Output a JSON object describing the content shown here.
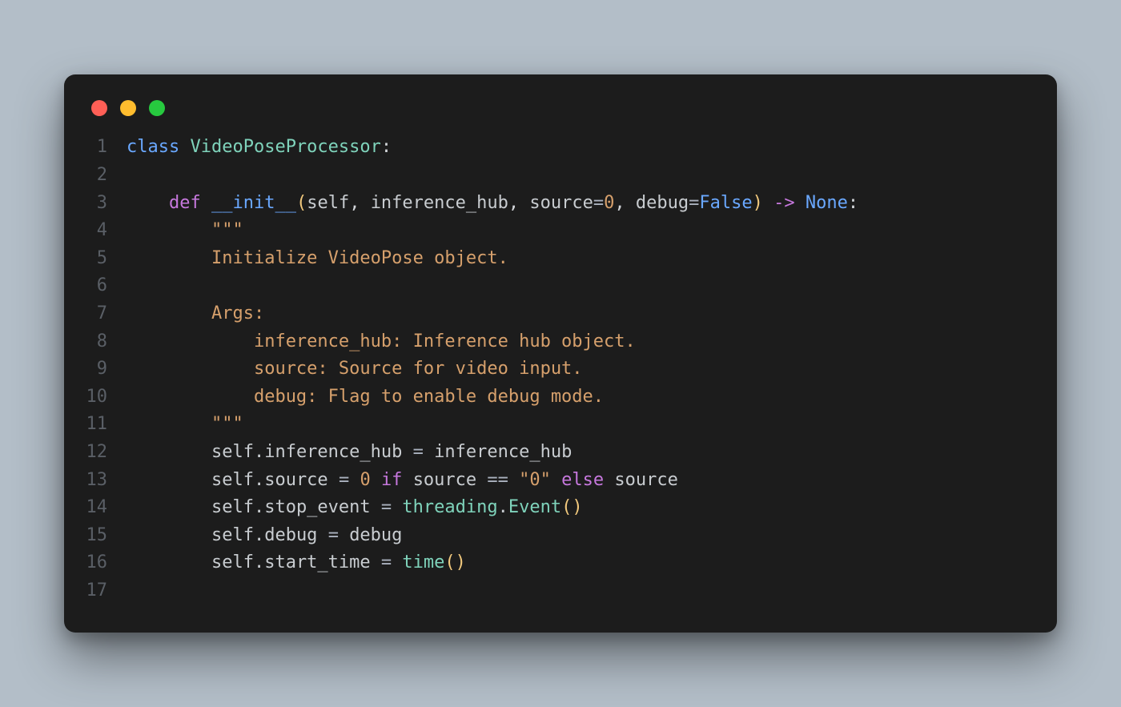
{
  "window": {
    "traffic_lights": [
      "close",
      "minimize",
      "zoom"
    ]
  },
  "colors": {
    "background": "#b3bec8",
    "editor_bg": "#1c1c1c",
    "red": "#ff5f56",
    "yellow": "#ffbd2e",
    "green": "#27c93f"
  },
  "gutter": [
    "1",
    "2",
    "3",
    "4",
    "5",
    "6",
    "7",
    "8",
    "9",
    "10",
    "11",
    "12",
    "13",
    "14",
    "15",
    "16",
    "17"
  ],
  "code": {
    "l1": {
      "kw": "class",
      "sp": " ",
      "name": "VideoPoseProcessor",
      "colon": ":"
    },
    "l2": {
      "blank": ""
    },
    "l3": {
      "indent": "    ",
      "kw": "def",
      "sp": " ",
      "fn": "__init__",
      "lp": "(",
      "p1": "self",
      "c1": ", ",
      "p2": "inference_hub",
      "c2": ", ",
      "p3": "source",
      "eq1": "=",
      "v3": "0",
      "c3": ", ",
      "p4": "debug",
      "eq2": "=",
      "v4": "False",
      "rp": ")",
      "sp2": " ",
      "arrow": "->",
      "sp3": " ",
      "ret": "None",
      "colon": ":"
    },
    "l4": {
      "indent": "        ",
      "q": "\"\"\""
    },
    "l5": {
      "indent": "        ",
      "t": "Initialize VideoPose object."
    },
    "l6": {
      "blank": ""
    },
    "l7": {
      "indent": "        ",
      "t": "Args:"
    },
    "l8": {
      "indent": "            ",
      "t": "inference_hub: Inference hub object."
    },
    "l9": {
      "indent": "            ",
      "t": "source: Source for video input."
    },
    "l10": {
      "indent": "            ",
      "t": "debug: Flag to enable debug mode."
    },
    "l11": {
      "indent": "        ",
      "q": "\"\"\""
    },
    "l12": {
      "indent": "        ",
      "self": "self",
      "dot": ".",
      "attr": "inference_hub",
      "sp": " ",
      "eq": "=",
      "sp2": " ",
      "rhs": "inference_hub"
    },
    "l13": {
      "indent": "        ",
      "self": "self",
      "dot": ".",
      "attr": "source",
      "sp": " ",
      "eq": "=",
      "sp2": " ",
      "zero": "0",
      "sp3": " ",
      "if": "if",
      "sp4": " ",
      "cond_l": "source",
      "sp5": " ",
      "cmp": "==",
      "sp6": " ",
      "str": "\"0\"",
      "sp7": " ",
      "else": "else",
      "sp8": " ",
      "cond_r": "source"
    },
    "l14": {
      "indent": "        ",
      "self": "self",
      "dot": ".",
      "attr": "stop_event",
      "sp": " ",
      "eq": "=",
      "sp2": " ",
      "mod": "threading",
      "dot2": ".",
      "call": "Event",
      "lp": "(",
      "rp": ")"
    },
    "l15": {
      "indent": "        ",
      "self": "self",
      "dot": ".",
      "attr": "debug",
      "sp": " ",
      "eq": "=",
      "sp2": " ",
      "rhs": "debug"
    },
    "l16": {
      "indent": "        ",
      "self": "self",
      "dot": ".",
      "attr": "start_time",
      "sp": " ",
      "eq": "=",
      "sp2": " ",
      "call": "time",
      "lp": "(",
      "rp": ")"
    },
    "l17": {
      "blank": ""
    }
  }
}
